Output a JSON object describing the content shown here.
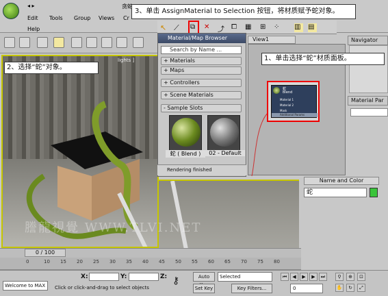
{
  "menu": {
    "items": [
      "Edit",
      "Tools",
      "Group",
      "Views",
      "Cr"
    ],
    "second_row": [
      "Help"
    ],
    "title_fragment": "贪蛇"
  },
  "viewport": {
    "label_fragment": "lights ]",
    "watermark": "謄龍視覺 WWW.TLVI.NET"
  },
  "material_browser": {
    "title": "Material/Map Browser",
    "search_placeholder": "Search by Name ...",
    "rollouts": [
      "+ Materials",
      "+ Maps",
      "+ Controllers",
      "+ Scene Materials",
      "- Sample Slots"
    ],
    "slots": [
      {
        "label": "蛇 ( Blend )"
      },
      {
        "label": "02 - Default"
      }
    ],
    "status": "Rendering finished"
  },
  "view1": {
    "tab": "View1",
    "node": {
      "name": "蛇",
      "type": "Blend",
      "pins": [
        "Material 1",
        "Material 2",
        "Mask",
        "Additional Params",
        "mr Connection"
      ]
    }
  },
  "right_panel": {
    "navigator": "Navigator",
    "material_param": "Material Par",
    "name_and_color": "Name and Color",
    "name_value": "蛇",
    "color": "#3ac43a"
  },
  "captions": {
    "step1": "1、单击选择“蛇”材质面板。",
    "step2": "2、选择“蛇”对象。",
    "step3": "3、单击 AssignMaterial to Selection 按钮，将材质赋予蛇对象。"
  },
  "timeline": {
    "frame_label": "0 / 100",
    "ticks": [
      "0",
      "10",
      "15",
      "20",
      "25",
      "30",
      "35",
      "40",
      "45",
      "50",
      "55",
      "60",
      "65",
      "70",
      "75",
      "80"
    ]
  },
  "status": {
    "welcome": "Welcome to MAX",
    "prompt": "Click or click-and-drag to select objects",
    "x_label": "X:",
    "y_label": "Y:",
    "z_label": "Z:",
    "auto_key": "Auto Key",
    "set_key": "Set Key",
    "selected": "Selected",
    "key_filters": "Key Filters...",
    "frame": "0"
  }
}
